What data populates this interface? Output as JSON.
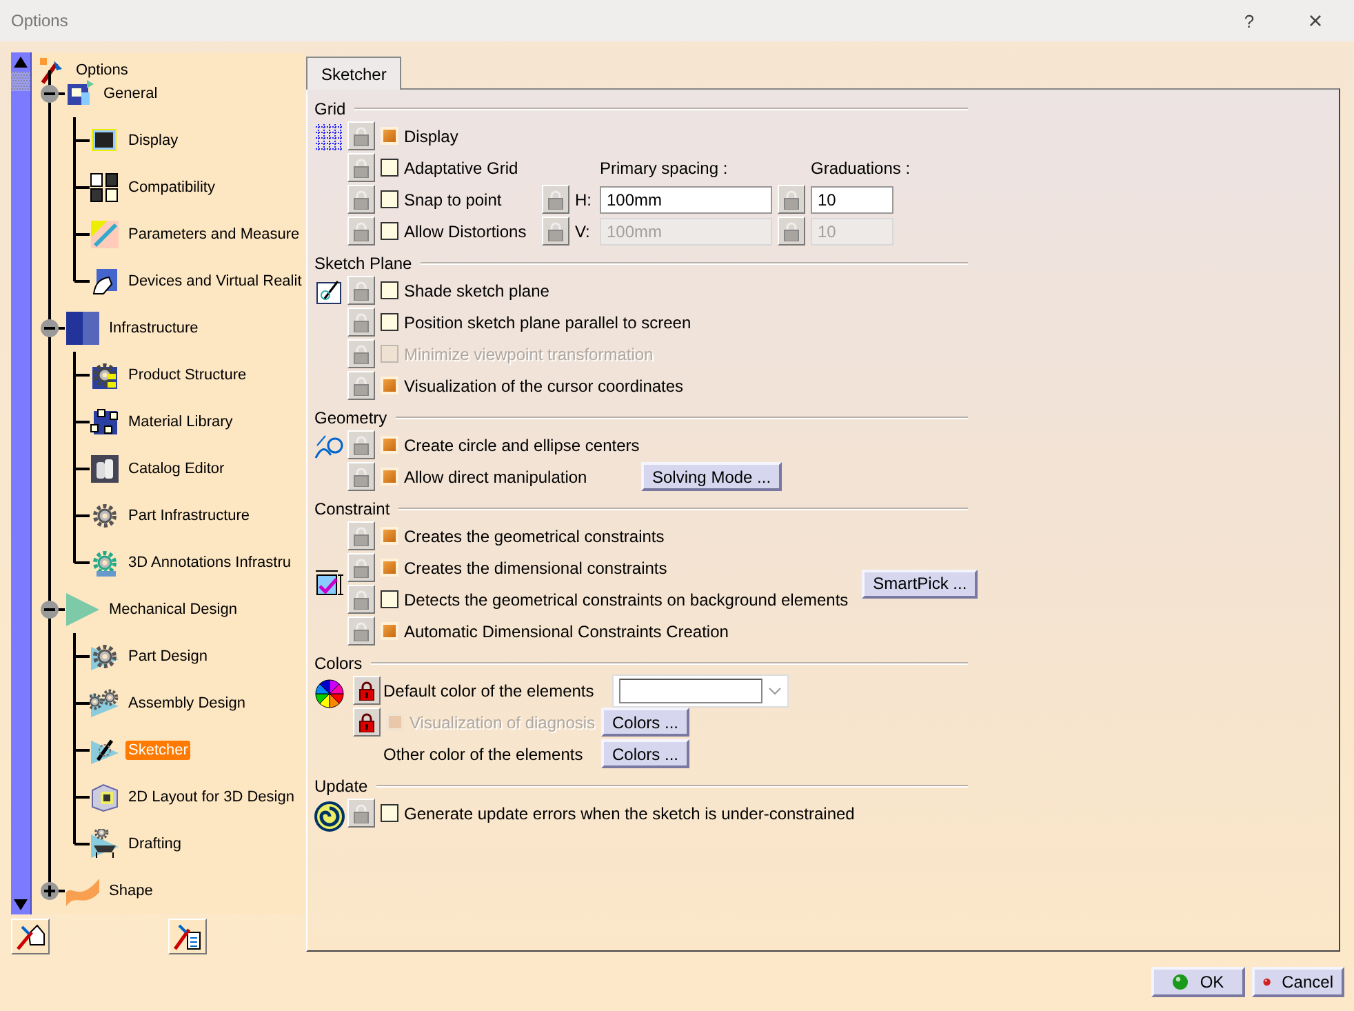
{
  "window": {
    "title": "Options",
    "help": "?",
    "close": "×"
  },
  "tree": {
    "label": "Options",
    "selected": false,
    "children": [
      {
        "label": "General",
        "selected": false,
        "expanded": true,
        "children": [
          {
            "label": "Display",
            "selected": false
          },
          {
            "label": "Compatibility",
            "selected": false
          },
          {
            "label": "Parameters and Measure",
            "selected": false
          },
          {
            "label": "Devices and Virtual Realit",
            "selected": false
          }
        ]
      },
      {
        "label": "Infrastructure",
        "selected": false,
        "expanded": true,
        "children": [
          {
            "label": "Product Structure",
            "selected": false
          },
          {
            "label": "Material Library",
            "selected": false
          },
          {
            "label": "Catalog Editor",
            "selected": false
          },
          {
            "label": "Part Infrastructure",
            "selected": false
          },
          {
            "label": "3D Annotations Infrastru",
            "selected": false
          }
        ]
      },
      {
        "label": "Mechanical Design",
        "selected": false,
        "expanded": true,
        "children": [
          {
            "label": "Part Design",
            "selected": false
          },
          {
            "label": "Assembly Design",
            "selected": false
          },
          {
            "label": "Sketcher",
            "selected": true
          },
          {
            "label": "2D Layout for 3D Design",
            "selected": false
          },
          {
            "label": "Drafting",
            "selected": false
          }
        ]
      },
      {
        "label": "Shape",
        "selected": false,
        "expanded": false
      }
    ]
  },
  "tabs": [
    {
      "label": "Sketcher",
      "selected": true
    }
  ],
  "sections": [
    {
      "kind": "grid",
      "title": "Grid",
      "rows": [
        {
          "label": "Display",
          "checked": true,
          "disabled": false,
          "locked": false
        },
        {
          "label": "Adaptative Grid",
          "checked": false,
          "disabled": false,
          "locked": false
        },
        {
          "label": "Snap to point",
          "checked": false,
          "disabled": false,
          "locked": false
        },
        {
          "label": "Allow Distortions",
          "checked": false,
          "disabled": false,
          "locked": false
        }
      ],
      "spacing": {
        "primary_label": "Primary spacing :",
        "graduations_label": "Graduations :",
        "rows": [
          {
            "axis": "H:",
            "primary": "100mm",
            "graduations": "10",
            "disabled": false
          },
          {
            "axis": "V:",
            "primary": "100mm",
            "graduations": "10",
            "disabled": true
          }
        ]
      }
    },
    {
      "kind": "checklist",
      "title": "Sketch Plane",
      "rows": [
        {
          "kind": "checkbox",
          "label": "Shade sketch plane",
          "checked": false,
          "disabled": false,
          "locked": false
        },
        {
          "kind": "checkbox",
          "label": "Position sketch plane parallel to screen",
          "checked": false,
          "disabled": false,
          "locked": false
        },
        {
          "kind": "checkbox",
          "label": "Minimize viewpoint transformation",
          "checked": false,
          "disabled": true,
          "locked": false
        },
        {
          "kind": "checkbox",
          "label": "Visualization of the cursor coordinates",
          "checked": true,
          "disabled": false,
          "locked": false
        }
      ]
    },
    {
      "kind": "checklist",
      "title": "Geometry",
      "rows": [
        {
          "kind": "checkbox",
          "label": "Create circle and ellipse centers",
          "checked": true,
          "disabled": false,
          "locked": false
        },
        {
          "kind": "checkbox",
          "label": "Allow direct manipulation",
          "checked": true,
          "disabled": false,
          "locked": false,
          "button": "Solving Mode ..."
        }
      ]
    },
    {
      "kind": "checklist",
      "title": "Constraint",
      "side_button": "SmartPick ...",
      "rows": [
        {
          "kind": "checkbox",
          "label": "Creates the geometrical constraints",
          "checked": true,
          "disabled": false,
          "locked": false
        },
        {
          "kind": "checkbox",
          "label": "Creates the dimensional constraints",
          "checked": true,
          "disabled": false,
          "locked": false
        },
        {
          "kind": "checkbox",
          "label": "Detects the geometrical constraints on background elements",
          "checked": false,
          "disabled": false,
          "locked": false
        },
        {
          "kind": "checkbox",
          "label": "Automatic Dimensional Constraints Creation",
          "checked": true,
          "disabled": false,
          "locked": false
        }
      ]
    },
    {
      "kind": "colors",
      "title": "Colors",
      "rows": [
        {
          "kind": "dropdown",
          "label": "Default color of the elements",
          "locked": true
        },
        {
          "kind": "checkbox",
          "label": "Visualization of diagnosis",
          "checked": true,
          "disabled": true,
          "locked": true,
          "button": "Colors ..."
        },
        {
          "kind": "text",
          "label": "Other color of the elements",
          "button": "Colors ..."
        }
      ]
    },
    {
      "kind": "checklist",
      "title": "Update",
      "rows": [
        {
          "kind": "checkbox",
          "label": "Generate update errors when the sketch is under-constrained",
          "checked": false,
          "disabled": false,
          "locked": false
        }
      ]
    }
  ],
  "buttons": [
    {
      "kind": "ok",
      "label": "OK"
    },
    {
      "kind": "cancel",
      "label": "Cancel"
    }
  ]
}
